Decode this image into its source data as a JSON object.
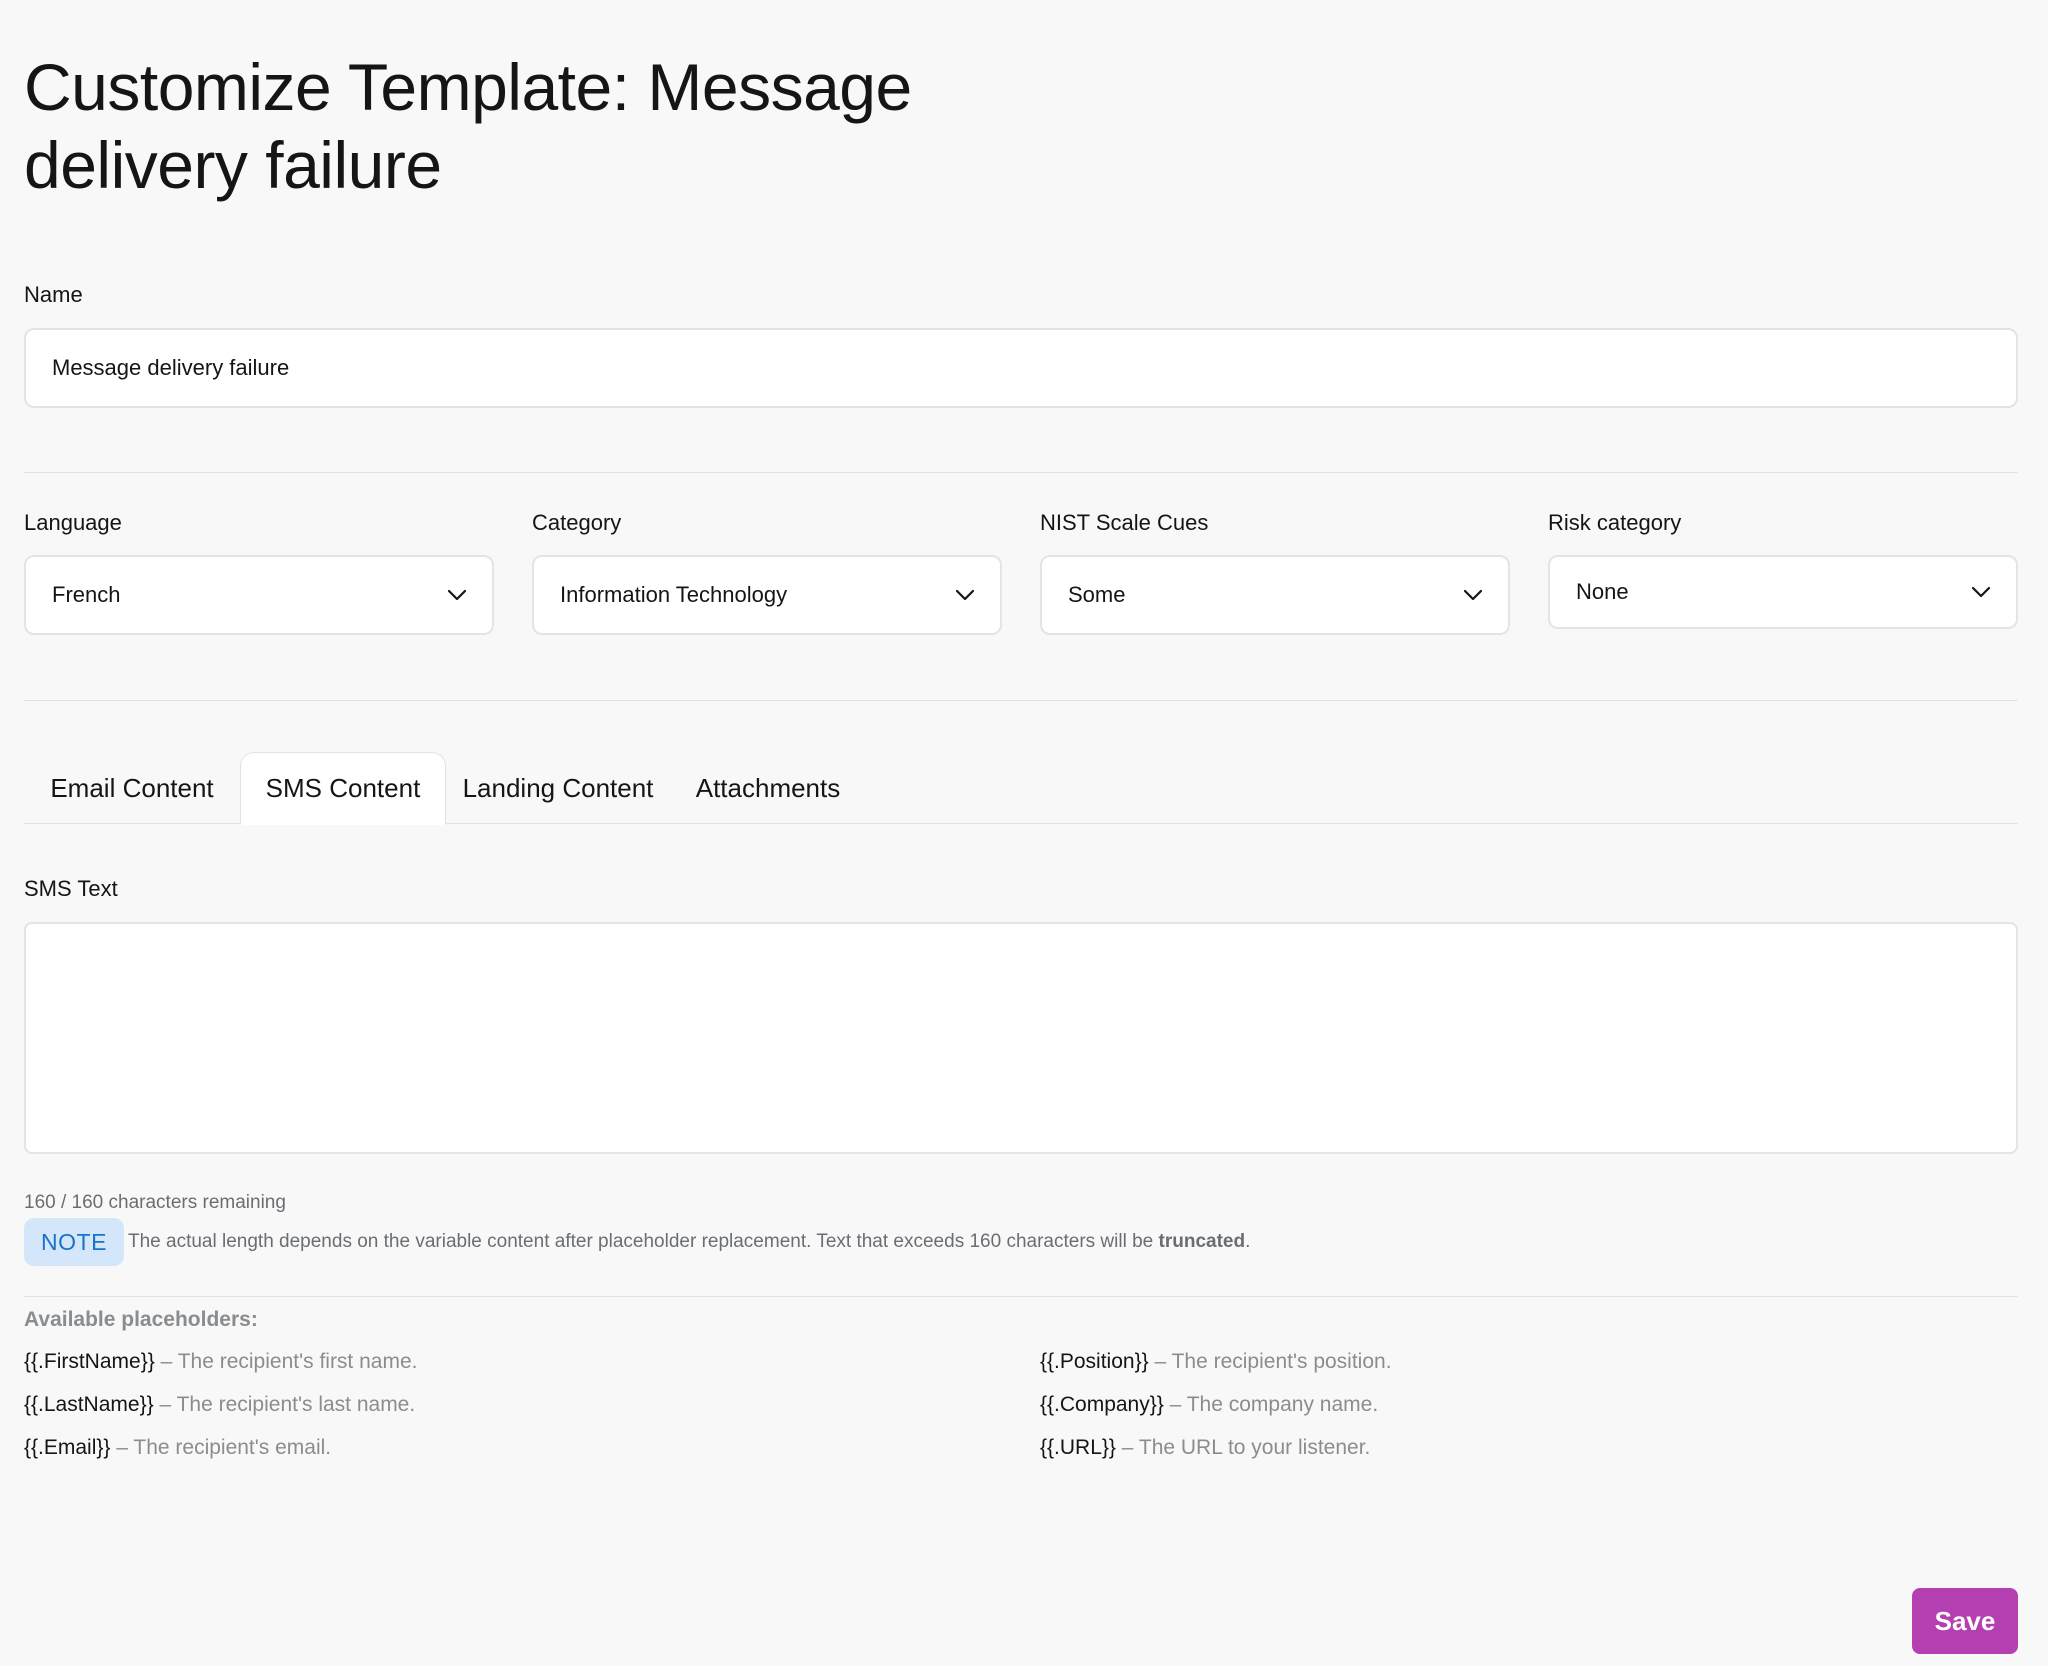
{
  "page": {
    "title": "Customize Template: Message delivery failure"
  },
  "name_field": {
    "label": "Name",
    "value": "Message delivery failure"
  },
  "selects": {
    "language": {
      "label": "Language",
      "value": "French"
    },
    "category": {
      "label": "Category",
      "value": "Information Technology"
    },
    "nist": {
      "label": "NIST Scale Cues",
      "value": "Some"
    },
    "risk": {
      "label": "Risk category",
      "value": "None"
    }
  },
  "tabs": [
    {
      "label": "Email Content",
      "active": false
    },
    {
      "label": "SMS Content",
      "active": true
    },
    {
      "label": "Landing Content",
      "active": false
    },
    {
      "label": "Attachments",
      "active": false
    }
  ],
  "sms": {
    "label": "SMS Text",
    "value": "",
    "remaining": "160 / 160 characters remaining",
    "note_badge": "NOTE",
    "note_text": "The actual length depends on the variable content after placeholder replacement. Text that exceeds 160 characters will be ",
    "note_bold": "truncated",
    "note_end": "."
  },
  "placeholders": {
    "heading": "Available placeholders:",
    "left": [
      {
        "code": "{{.FirstName}}",
        "desc": " – The recipient's first name."
      },
      {
        "code": "{{.LastName}}",
        "desc": " – The recipient's last name."
      },
      {
        "code": "{{.Email}}",
        "desc": " – The recipient's email."
      }
    ],
    "right": [
      {
        "code": "{{.Position}}",
        "desc": " – The recipient's position."
      },
      {
        "code": "{{.Company}}",
        "desc": " – The company name."
      },
      {
        "code": "{{.URL}}",
        "desc": " – The URL to your listener."
      }
    ]
  },
  "actions": {
    "save_label": "Save"
  },
  "colors": {
    "accent": "#b43fb1",
    "note_bg": "#d3e6fa",
    "note_fg": "#1a73c7",
    "background": "#f8f8f8"
  },
  "icons": {
    "dropdown": "chevron-down-icon"
  }
}
